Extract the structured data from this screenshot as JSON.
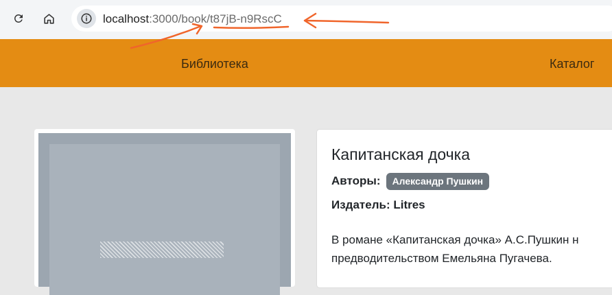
{
  "browser": {
    "url": {
      "host": "localhost",
      "rest": ":3000/book/t87jB-n9RscC"
    },
    "icons": {
      "reload": "reload-icon",
      "home": "home-icon",
      "site_info": "info-icon"
    }
  },
  "header": {
    "nav": {
      "library": "Библиотека",
      "catalog": "Каталог"
    },
    "color": "#e48c13"
  },
  "book": {
    "title": "Капитанская дочка",
    "authors_label": "Авторы:",
    "authors": [
      "Александр Пушкин"
    ],
    "publisher_label": "Издатель:",
    "publisher": "Litres",
    "description_lines": [
      "В романе «Капитанская дочка» А.С.Пушкин н",
      "предводительством Емельяна Пугачева."
    ]
  },
  "annotations": {
    "arrow_color": "#f0652b"
  }
}
